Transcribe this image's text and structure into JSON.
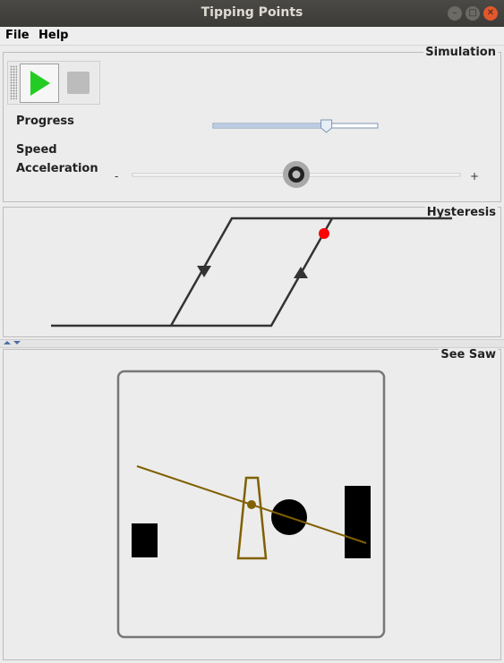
{
  "window": {
    "title": "Tipping Points"
  },
  "menu": {
    "file": "File",
    "help": "Help"
  },
  "simulation": {
    "title": "Simulation",
    "progress_label": "Progress",
    "speed_label": "Speed",
    "acceleration_label": "Acceleration",
    "progress_value_fraction": 0.69,
    "acceleration_value_fraction": 0.5,
    "slider_min_symbol": "-",
    "slider_max_symbol": "+",
    "play_color": "#22cc22"
  },
  "hysteresis": {
    "title": "Hysteresis",
    "marker_color": "#ff0000"
  },
  "seesaw": {
    "title": "See Saw",
    "beam_color": "#806000"
  }
}
